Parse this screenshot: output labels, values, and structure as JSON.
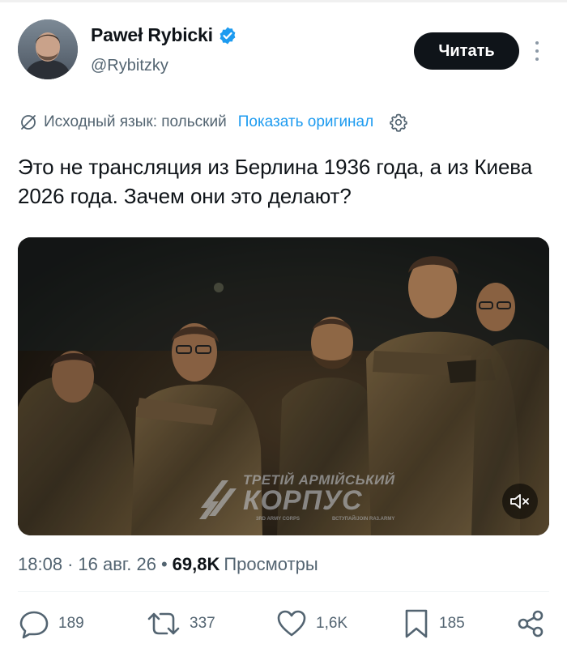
{
  "author": {
    "display_name": "Paweł Rybicki",
    "handle": "@Rybitzky",
    "verified": true
  },
  "follow_label": "Читать",
  "translation": {
    "source_label": "Исходный язык: польский",
    "show_original_label": "Показать оригинал"
  },
  "tweet": {
    "text": "Это не трансляция из Берлина 1936 года, а из Киева 2026 года. Зачем они это делают?"
  },
  "media": {
    "watermark_title_1": "ТРЕТІЙ АРМІЙСЬКИЙ",
    "watermark_title_2": "КОРПУС",
    "watermark_sub_1": "3RD ARMY CORPS",
    "watermark_sub_2": "ВСТУПАЙ/JOIN RA3.ARMY",
    "muted": true
  },
  "meta": {
    "time": "18:08",
    "separator": "·",
    "date": "16 авг. 26",
    "bullet": "•",
    "views_count": "69,8K",
    "views_label": "Просмотры"
  },
  "actions": {
    "replies": "189",
    "reposts": "337",
    "likes": "1,6K",
    "bookmarks": "185"
  },
  "colors": {
    "text": "#0f1419",
    "secondary": "#536471",
    "link": "#1d9bf0",
    "verified": "#1d9bf0"
  }
}
